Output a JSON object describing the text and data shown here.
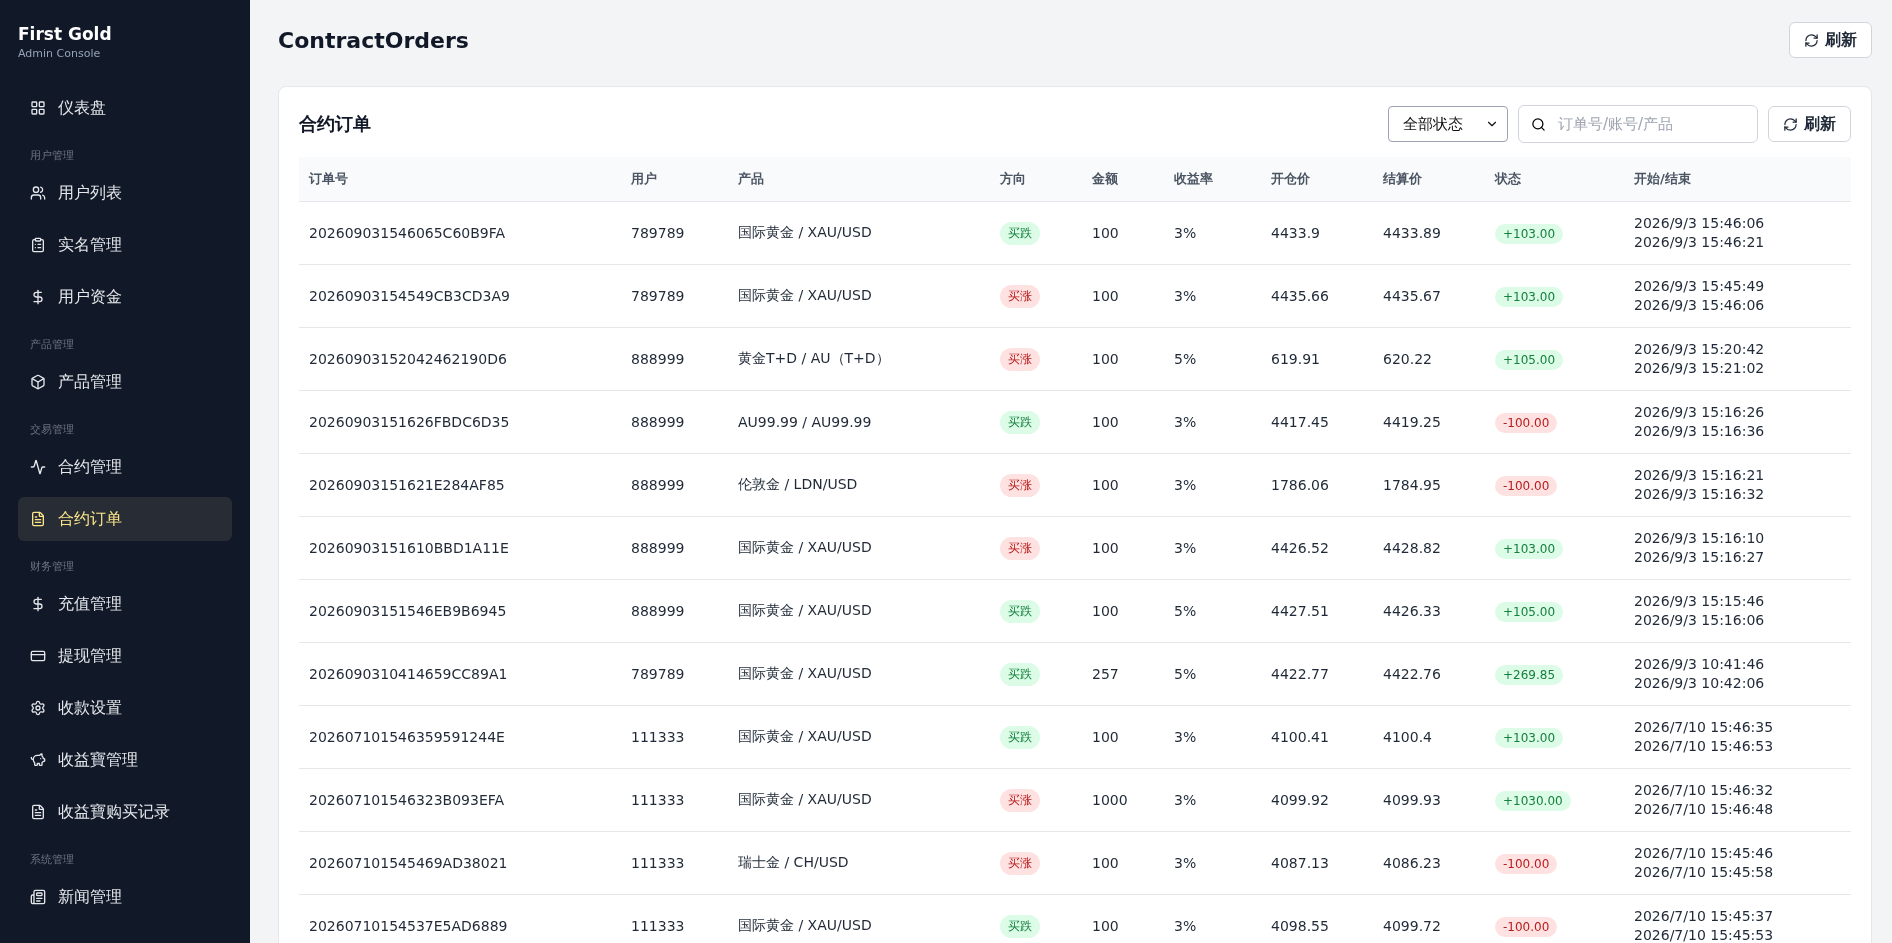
{
  "brand": {
    "title": "First Gold",
    "subtitle": "Admin Console"
  },
  "sidebar": {
    "sections": [
      {
        "items": [
          {
            "label": "仪表盘",
            "selected": false
          }
        ]
      },
      {
        "heading": "用户管理",
        "items": [
          {
            "label": "用户列表",
            "selected": false
          },
          {
            "label": "实名管理",
            "selected": false
          },
          {
            "label": "用户资金",
            "selected": false
          }
        ]
      },
      {
        "heading": "产品管理",
        "items": [
          {
            "label": "产品管理",
            "selected": false
          }
        ]
      },
      {
        "heading": "交易管理",
        "items": [
          {
            "label": "合约管理",
            "selected": false
          },
          {
            "label": "合约订单",
            "selected": true
          }
        ]
      },
      {
        "heading": "财务管理",
        "items": [
          {
            "label": "充值管理",
            "selected": false
          },
          {
            "label": "提现管理",
            "selected": false
          },
          {
            "label": "收款设置",
            "selected": false
          },
          {
            "label": "收益寶管理",
            "selected": false
          },
          {
            "label": "收益寶购买记录",
            "selected": false
          }
        ]
      },
      {
        "heading": "系统管理",
        "items": [
          {
            "label": "新闻管理",
            "selected": false
          }
        ]
      }
    ]
  },
  "page": {
    "title": "ContractOrders",
    "refresh_button": "刷新"
  },
  "card": {
    "title": "合约订单",
    "status_filter": "全部状态",
    "search": {
      "placeholder": "订单号/账号/产品"
    },
    "refresh_button": "刷新"
  },
  "table": {
    "columns": [
      "订单号",
      "用户",
      "产品",
      "方向",
      "金额",
      "收益率",
      "开仓价",
      "结算价",
      "状态",
      "开始/结束"
    ],
    "rows": [
      {
        "order": "202609031546065C60B9FA",
        "user": "789789",
        "product": "国际黄金 / XAU/USD",
        "direction": {
          "label": "买跌",
          "kind": "down"
        },
        "amount": "100",
        "rate": "3%",
        "open": "4433.9",
        "settle": "4433.89",
        "status": {
          "label": "+103.00",
          "kind": "profit"
        },
        "start": "2026/9/3 15:46:06",
        "end": "2026/9/3 15:46:21"
      },
      {
        "order": "20260903154549CB3CD3A9",
        "user": "789789",
        "product": "国际黄金 / XAU/USD",
        "direction": {
          "label": "买涨",
          "kind": "up"
        },
        "amount": "100",
        "rate": "3%",
        "open": "4435.66",
        "settle": "4435.67",
        "status": {
          "label": "+103.00",
          "kind": "profit"
        },
        "start": "2026/9/3 15:45:49",
        "end": "2026/9/3 15:46:06"
      },
      {
        "order": "20260903152042462190D6",
        "user": "888999",
        "product": "黄金T+D / AU（T+D）",
        "direction": {
          "label": "买涨",
          "kind": "up"
        },
        "amount": "100",
        "rate": "5%",
        "open": "619.91",
        "settle": "620.22",
        "status": {
          "label": "+105.00",
          "kind": "profit"
        },
        "start": "2026/9/3 15:20:42",
        "end": "2026/9/3 15:21:02"
      },
      {
        "order": "20260903151626FBDC6D35",
        "user": "888999",
        "product": "AU99.99 / AU99.99",
        "direction": {
          "label": "买跌",
          "kind": "down"
        },
        "amount": "100",
        "rate": "3%",
        "open": "4417.45",
        "settle": "4419.25",
        "status": {
          "label": "-100.00",
          "kind": "loss"
        },
        "start": "2026/9/3 15:16:26",
        "end": "2026/9/3 15:16:36"
      },
      {
        "order": "20260903151621E284AF85",
        "user": "888999",
        "product": "伦敦金 / LDN/USD",
        "direction": {
          "label": "买涨",
          "kind": "up"
        },
        "amount": "100",
        "rate": "3%",
        "open": "1786.06",
        "settle": "1784.95",
        "status": {
          "label": "-100.00",
          "kind": "loss"
        },
        "start": "2026/9/3 15:16:21",
        "end": "2026/9/3 15:16:32"
      },
      {
        "order": "20260903151610BBD1A11E",
        "user": "888999",
        "product": "国际黄金 / XAU/USD",
        "direction": {
          "label": "买涨",
          "kind": "up"
        },
        "amount": "100",
        "rate": "3%",
        "open": "4426.52",
        "settle": "4428.82",
        "status": {
          "label": "+103.00",
          "kind": "profit"
        },
        "start": "2026/9/3 15:16:10",
        "end": "2026/9/3 15:16:27"
      },
      {
        "order": "20260903151546EB9B6945",
        "user": "888999",
        "product": "国际黄金 / XAU/USD",
        "direction": {
          "label": "买跌",
          "kind": "down"
        },
        "amount": "100",
        "rate": "5%",
        "open": "4427.51",
        "settle": "4426.33",
        "status": {
          "label": "+105.00",
          "kind": "profit"
        },
        "start": "2026/9/3 15:15:46",
        "end": "2026/9/3 15:16:06"
      },
      {
        "order": "2026090310414659CC89A1",
        "user": "789789",
        "product": "国际黄金 / XAU/USD",
        "direction": {
          "label": "买跌",
          "kind": "down"
        },
        "amount": "257",
        "rate": "5%",
        "open": "4422.77",
        "settle": "4422.76",
        "status": {
          "label": "+269.85",
          "kind": "profit"
        },
        "start": "2026/9/3 10:41:46",
        "end": "2026/9/3 10:42:06"
      },
      {
        "order": "202607101546359591244E",
        "user": "111333",
        "product": "国际黄金 / XAU/USD",
        "direction": {
          "label": "买跌",
          "kind": "down"
        },
        "amount": "100",
        "rate": "3%",
        "open": "4100.41",
        "settle": "4100.4",
        "status": {
          "label": "+103.00",
          "kind": "profit"
        },
        "start": "2026/7/10 15:46:35",
        "end": "2026/7/10 15:46:53"
      },
      {
        "order": "202607101546323B093EFA",
        "user": "111333",
        "product": "国际黄金 / XAU/USD",
        "direction": {
          "label": "买涨",
          "kind": "up"
        },
        "amount": "1000",
        "rate": "3%",
        "open": "4099.92",
        "settle": "4099.93",
        "status": {
          "label": "+1030.00",
          "kind": "profit"
        },
        "start": "2026/7/10 15:46:32",
        "end": "2026/7/10 15:46:48"
      },
      {
        "order": "202607101545469AD38021",
        "user": "111333",
        "product": "瑞士金 / CH/USD",
        "direction": {
          "label": "买涨",
          "kind": "up"
        },
        "amount": "100",
        "rate": "3%",
        "open": "4087.13",
        "settle": "4086.23",
        "status": {
          "label": "-100.00",
          "kind": "loss"
        },
        "start": "2026/7/10 15:45:46",
        "end": "2026/7/10 15:45:58"
      },
      {
        "order": "20260710154537E5AD6889",
        "user": "111333",
        "product": "国际黄金 / XAU/USD",
        "direction": {
          "label": "买跌",
          "kind": "down"
        },
        "amount": "100",
        "rate": "3%",
        "open": "4098.55",
        "settle": "4099.72",
        "status": {
          "label": "-100.00",
          "kind": "loss"
        },
        "start": "2026/7/10 15:45:37",
        "end": "2026/7/10 15:45:53"
      }
    ]
  }
}
